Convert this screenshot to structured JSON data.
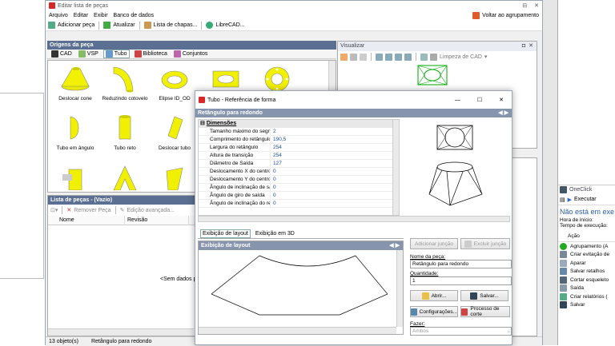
{
  "main_window": {
    "title": "Editar lista de peças",
    "menu": [
      "Arquivo",
      "Editar",
      "Exibir",
      "Banco de dados"
    ],
    "back_button": "Voltar ao agrupamento",
    "toolbar": {
      "add_part": "Adicionar peça",
      "update": "Atualizar",
      "sheet_list": "Lista de chapas...",
      "librecad": "LibreCAD..."
    },
    "origins": {
      "header": "Origens da peça",
      "tabs": [
        "CAD",
        "VSP",
        "Tubo",
        "Biblioteca",
        "Conjuntos"
      ],
      "items": [
        "Deslocar cone",
        "Reduzindo cotovelo",
        "Elipse ID_OD",
        "",
        "",
        "Tubo em ângulo",
        "Tubo reto",
        "Deslocar tubo"
      ]
    },
    "parts_list": {
      "header": "Lista de peças  - (Vazio)",
      "remove": "Remover Peça",
      "advanced_edit": "Edição avançada...",
      "columns": [
        "Nome",
        "Revisão"
      ],
      "empty": "<Sem dados p"
    },
    "viewer": {
      "header": "Visualizar",
      "clear": "Limpeza de CAD"
    },
    "status": {
      "count": "13 objeto(s)",
      "selected": "Retângulo para redondo"
    }
  },
  "dialog": {
    "title": "Tubo - Referência de forma",
    "header": "Retângulo para redondo",
    "group": "Dimensões",
    "properties": [
      {
        "k": "Tamanho máximo do segm",
        "v": "2"
      },
      {
        "k": "Comprimento do retângulo",
        "v": "190,5"
      },
      {
        "k": "Largura do retângulo",
        "v": "254"
      },
      {
        "k": "Altura de transição",
        "v": "254"
      },
      {
        "k": "Diâmetro de Saída",
        "v": "127"
      },
      {
        "k": "Deslocamento X do centro",
        "v": "0"
      },
      {
        "k": "Deslocamento Y do centro",
        "v": "0"
      },
      {
        "k": "Ângulo de inclinação de sa",
        "v": "0"
      },
      {
        "k": "Ângulo de giro de saída",
        "v": "0"
      },
      {
        "k": "Ângulo de inclinação do re",
        "v": "0"
      }
    ],
    "tabs": [
      "Exibição de layout",
      "Exibição em 3D"
    ],
    "layout_header": "Exibição de layout",
    "add_joint": "Adicionar junção",
    "remove_joint": "Excluir junção",
    "name_label": "Nome da peça:",
    "name_value": "Retângulo para redondo",
    "qty_label": "Quantidade:",
    "qty_value": "1",
    "open": "Abrir...",
    "save": "Salvar...",
    "config": "Configurações...",
    "cut_process": "Processo de corte",
    "make_label": "Fazer:",
    "make_value": "Ambos"
  },
  "oneclick": {
    "title": "OneClick",
    "run": "Executar",
    "status": "Não está em exe",
    "start_label": "Hora de início:",
    "exec_label": "Tempo de execução:",
    "action_header": "Ação",
    "actions": [
      "Agrupamento (A",
      "Criar evitação de",
      "Aparar",
      "Salvar retalhos",
      "Cortar esqueleto",
      "Saída",
      "Criar relatórios (",
      "Salvar"
    ]
  }
}
